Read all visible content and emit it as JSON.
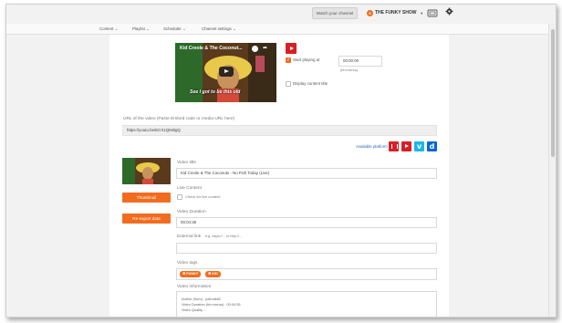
{
  "header": {
    "watch_button": "Watch your channel",
    "avatar_initial": "S",
    "channel_name": "THE FUNKY SHOW",
    "channel_caret": "▾"
  },
  "nav": {
    "items": [
      {
        "label": "Content ⌄"
      },
      {
        "label": "Playlist ⌄"
      },
      {
        "label": "Scheduler ⌄"
      },
      {
        "label": "Channel settings ⌄"
      }
    ]
  },
  "embed": {
    "title": "Kid Creole & The Coconut...",
    "share": "➦",
    "caption": "See I got to be this old"
  },
  "playback": {
    "start_playing_label": "Start playing at",
    "start_time": "00:00:00",
    "time_format": "(hh:mm:ss)",
    "display_title_label": "Display content title"
  },
  "url_section": {
    "label": "URL of the video (Paste Embed code or media URL here)",
    "value": "https://youtu.be/ECX1Qts6lgQ",
    "available_platform": "Available platform"
  },
  "left": {
    "thumbnail_button": "Thumbnail",
    "reexport_button": "Re-export data"
  },
  "form": {
    "video_title_label": "Video title",
    "video_title_value": "Kid Creole & The Coconuts - No Fish Today (Live)",
    "live_label": "Live Content",
    "live_checkbox_label": "Check for live content",
    "duration_label": "Video Duration",
    "duration_value": "00:04:35",
    "external_link_label": "External link",
    "external_link_hint": "e.g. https://... or http://...",
    "tags_label": "Video tags",
    "tags": [
      "✖ FUNKY",
      "✖ KID"
    ],
    "info_label": "Video information",
    "info_lines": [
      "Author (from) : palmdk62",
      "Video Duration (hh:mm:ss) : 00:04:35",
      "Video Quality : -"
    ]
  }
}
